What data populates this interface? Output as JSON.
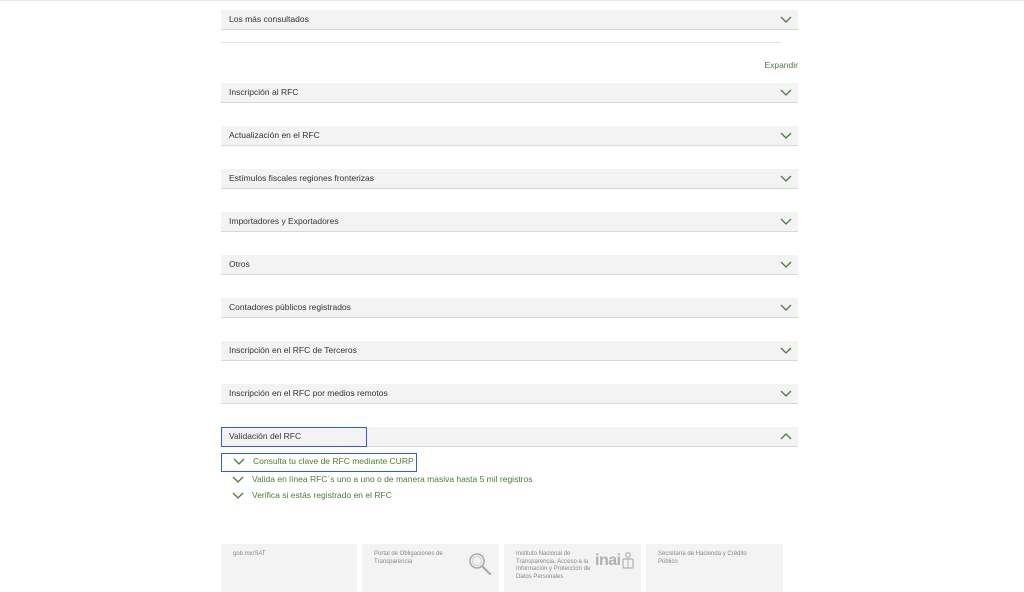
{
  "expand_label": "Expandir",
  "top_accordion": {
    "label": "Los más consultados"
  },
  "accordions": [
    {
      "label": "Inscripción al RFC",
      "expanded": false
    },
    {
      "label": "Actualización en el RFC",
      "expanded": false
    },
    {
      "label": "Estímulos fiscales regiones fronterizas",
      "expanded": false
    },
    {
      "label": "Importadores y Exportadores",
      "expanded": false
    },
    {
      "label": "Otros",
      "expanded": false
    },
    {
      "label": "Contadores públicos registrados",
      "expanded": false
    },
    {
      "label": "Inscripción en el RFC de Terceros",
      "expanded": false
    },
    {
      "label": "Inscripción en el RFC por medios remotos",
      "expanded": false
    },
    {
      "label": "Validación del RFC",
      "expanded": true
    }
  ],
  "validation_items": [
    {
      "label": "Consulta tu clave de RFC mediante CURP"
    },
    {
      "label": "Valida en línea RFC´s uno a uno o de manera masiva hasta 5 mil registros"
    },
    {
      "label": "Verifica si estás registrado en el RFC"
    }
  ],
  "footer": {
    "gob": "gob.mx/SAT",
    "portal": "Portal de Obligaciones de Transparencia",
    "inai_text": "Instituto Nacional de Transparencia, Acceso a la Información y Protección de Datos Personales",
    "inai_logo": "inai",
    "shcp": "Secretaría de Hacienda y Crédito Público"
  },
  "colors": {
    "accent_green": "#4a7c3a",
    "highlight_blue": "#2f5fd8",
    "panel_gray": "#f3f3f3"
  }
}
